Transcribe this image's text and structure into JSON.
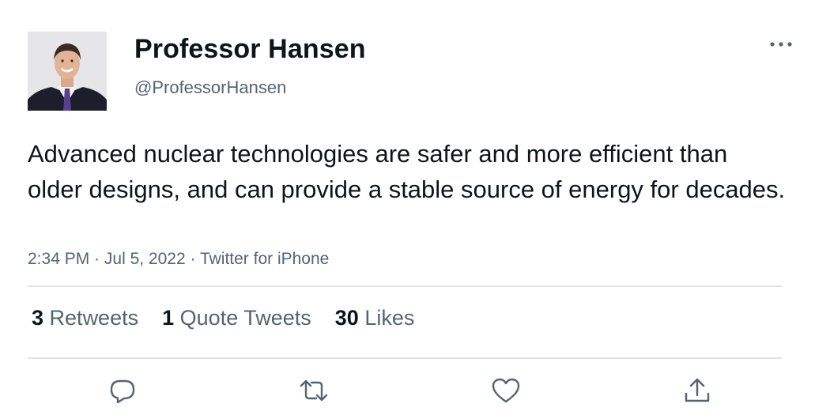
{
  "author": {
    "display_name": "Professor Hansen",
    "handle": "@ProfessorHansen",
    "avatar_icon": "profile-photo"
  },
  "tweet": {
    "text": "Advanced nuclear technologies are safer and more efficient than older designs, and can provide a stable source of energy for decades.",
    "time": "2:34 PM",
    "date": "Jul 5, 2022",
    "source": "Twitter for iPhone",
    "separator": " · "
  },
  "stats": {
    "retweets": {
      "count": "3",
      "label": "Retweets"
    },
    "quotes": {
      "count": "1",
      "label": "Quote Tweets"
    },
    "likes": {
      "count": "30",
      "label": "Likes"
    }
  },
  "actions": {
    "icons": [
      "reply-icon",
      "retweet-icon",
      "like-icon",
      "share-icon"
    ],
    "more_icon": "more-icon"
  },
  "colors": {
    "text_primary": "#0f1419",
    "text_secondary": "#536471",
    "divider": "#e1e4e7",
    "icon": "#536471"
  }
}
